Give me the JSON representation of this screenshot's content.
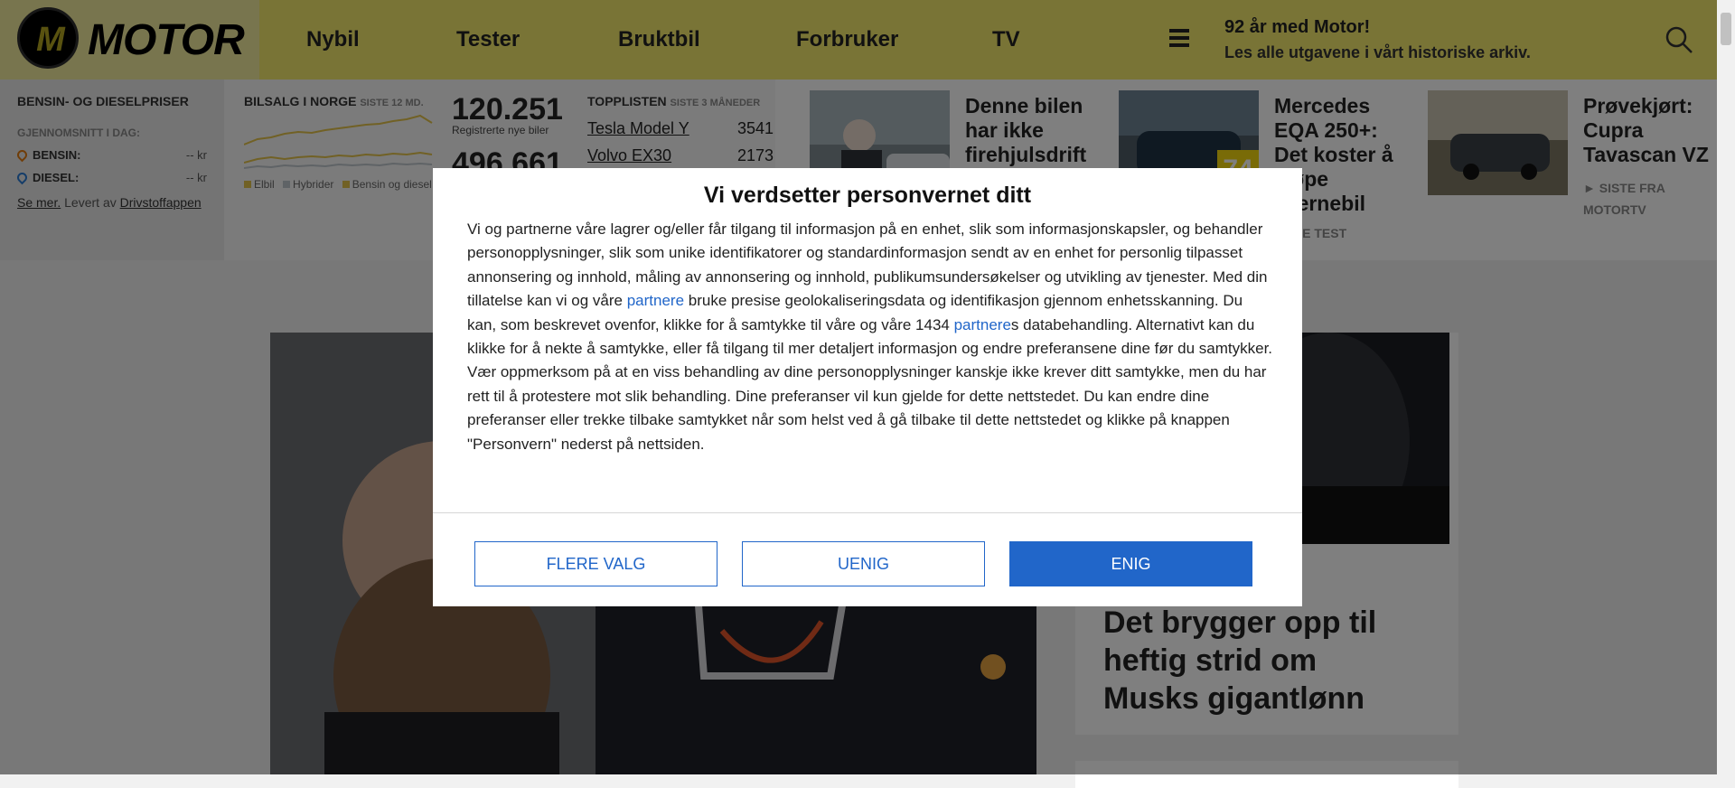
{
  "header": {
    "logo_letter": "M",
    "logo_text": "MOTOR",
    "nav": [
      "Nybil",
      "Tester",
      "Bruktbil",
      "Forbruker",
      "TV"
    ],
    "archive_title": "92 år med Motor!",
    "archive_subtitle": "Les alle utgavene i vårt historiske arkiv."
  },
  "fuel": {
    "heading": "BENSIN- OG DIESELPRISER",
    "subheading": "GJENNOMSNITT I DAG:",
    "rows": [
      {
        "label": "BENSIN:",
        "value": "-- kr",
        "color": "#e07a10"
      },
      {
        "label": "DIESEL:",
        "value": "-- kr",
        "color": "#2a7bd2"
      }
    ],
    "see_more": "Se mer.",
    "provided_by": "Levert av",
    "provider": "Drivstoffappen"
  },
  "sales": {
    "heading": "BILSALG I NORGE",
    "period": "SISTE 12 MD.",
    "registrations": "120.251",
    "registrations_caption": "Registrerte nye biler",
    "second_number": "496.661",
    "legend": [
      "Elbil",
      "Hybrider",
      "Bensin og diesel"
    ],
    "legend_colors": [
      "#e2c24a",
      "#bfc6cc",
      "#e2c24a"
    ]
  },
  "toplist": {
    "heading": "TOPPLISTEN",
    "period": "SISTE 3 MÅNEDER",
    "rows": [
      {
        "model": "Tesla Model Y",
        "count": "3541"
      },
      {
        "model": "Volvo EX30",
        "count": "2173"
      }
    ]
  },
  "teasers": [
    {
      "title": "Denne bilen har ikke firehjulsdrift",
      "kicker": ""
    },
    {
      "title": "Mercedes EQA 250+: Det koster å kjøpe lillernebil",
      "kicker": "SISTE TEST",
      "rating": "74"
    },
    {
      "title": "Prøvekjørt: Cupra Tavascan VZ",
      "kicker": "► SISTE FRA MOTORTV"
    }
  ],
  "main": {
    "side_title": "Det brygger opp til heftig strid om Musks gigantlønn"
  },
  "consent": {
    "title": "Vi verdsetter personvernet ditt",
    "text_1": "Vi og partnerne våre lagrer og/eller får tilgang til informasjon på en enhet, slik som informasjonskapsler, og behandler personopplysninger, slik som unike identifikatorer og standardinformasjon sendt av en enhet for personlig tilpasset annonsering og innhold, måling av annonsering og innhold, publikumsundersøkelser og utvikling av tjenester. Med din tillatelse kan vi og våre ",
    "link_1": "partnere",
    "text_2": " bruke presise geolokaliseringsdata og identifikasjon gjennom enhetsskanning. Du kan, som beskrevet ovenfor, klikke for å samtykke til våre og våre 1434 ",
    "link_2": "partnere",
    "text_3": "s databehandling. Alternativt kan du klikke for å nekte å samtykke, eller få tilgang til mer detaljert informasjon og endre preferansene dine før du samtykker. Vær oppmerksom på at en viss behandling av dine personopplysninger kanskje ikke krever ditt samtykke, men du har rett til å protestere mot slik behandling. Dine preferanser vil kun gjelde for dette nettstedet. Du kan endre dine preferanser eller trekke tilbake samtykket når som helst ved å gå tilbake til dette nettstedet og klikke på knappen \"Personvern\" nederst på nettsiden.",
    "buttons": {
      "more": "FLERE VALG",
      "disagree": "UENIG",
      "agree": "ENIG"
    },
    "accent_color": "#2166c9"
  }
}
